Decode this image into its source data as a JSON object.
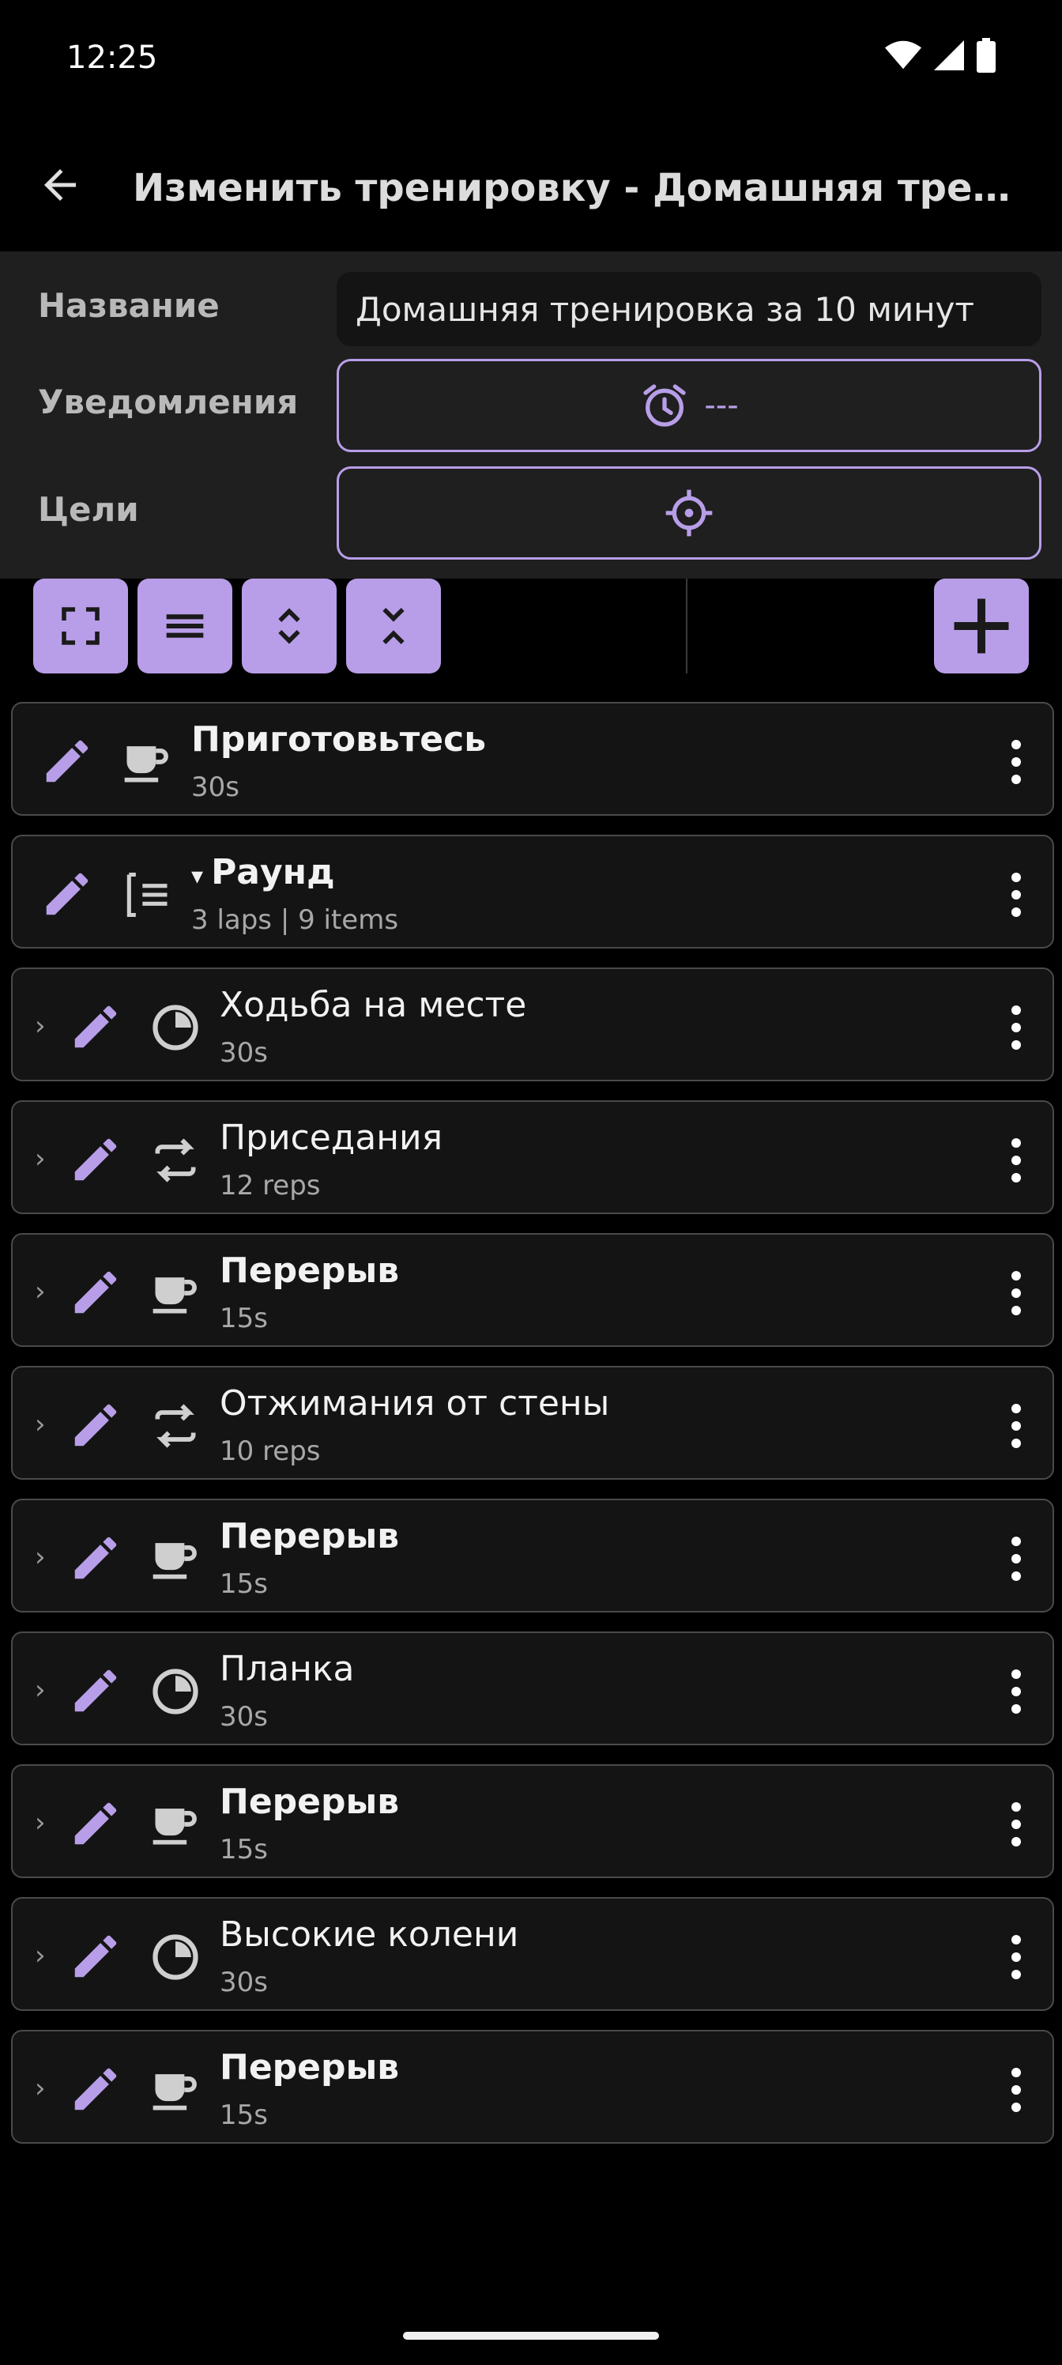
{
  "status_bar": {
    "time": "12:25",
    "icons": [
      "wifi-icon",
      "signal-icon",
      "battery-icon"
    ]
  },
  "app_bar": {
    "title": "Изменить тренировку - Домашняя тренир…",
    "back_icon": "arrow-back-icon"
  },
  "form": {
    "name_label": "Название",
    "name_value": "Домашняя тренировка за 10 минут",
    "notifications_label": "Уведомления",
    "notifications_value": "---",
    "goals_label": "Цели"
  },
  "toolbar": {
    "buttons": [
      "fullscreen-icon",
      "menu-lines-icon",
      "unfold-icon",
      "fold-icon"
    ],
    "add_icon": "plus-icon"
  },
  "colors": {
    "accent": "#b89ee8",
    "background": "#000000",
    "panel": "#1f1f1f",
    "card": "#141414"
  },
  "items": [
    {
      "title": "Приготовьтесь",
      "subtitle": "30s",
      "icon": "coffee-icon",
      "bold": true,
      "nested": false
    },
    {
      "title": "Раунд",
      "title_prefix": "▾",
      "subtitle": "3 laps | 9 items",
      "icon": "round-list-icon",
      "bold": true,
      "nested": false
    },
    {
      "title": "Ходьба на месте",
      "subtitle": "30s",
      "icon": "timer-icon",
      "bold": false,
      "nested": true
    },
    {
      "title": "Приседания",
      "subtitle": "12 reps",
      "icon": "repeat-icon",
      "bold": false,
      "nested": true
    },
    {
      "title": "Перерыв",
      "subtitle": "15s",
      "icon": "coffee-icon",
      "bold": true,
      "nested": true
    },
    {
      "title": "Отжимания от стены",
      "subtitle": "10 reps",
      "icon": "repeat-icon",
      "bold": false,
      "nested": true
    },
    {
      "title": "Перерыв",
      "subtitle": "15s",
      "icon": "coffee-icon",
      "bold": true,
      "nested": true
    },
    {
      "title": "Планка",
      "subtitle": "30s",
      "icon": "timer-icon",
      "bold": false,
      "nested": true
    },
    {
      "title": "Перерыв",
      "subtitle": "15s",
      "icon": "coffee-icon",
      "bold": true,
      "nested": true
    },
    {
      "title": "Высокие колени",
      "subtitle": "30s",
      "icon": "timer-icon",
      "bold": false,
      "nested": true
    },
    {
      "title": "Перерыв",
      "subtitle": "15s",
      "icon": "coffee-icon",
      "bold": true,
      "nested": true
    }
  ]
}
